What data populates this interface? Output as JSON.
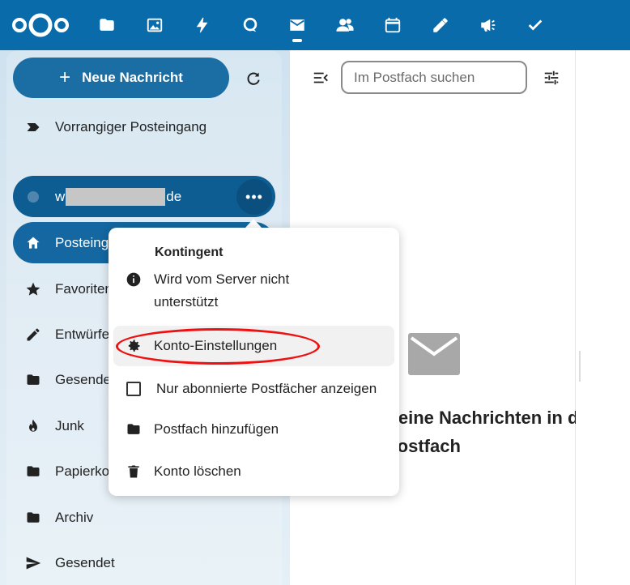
{
  "topbar": {
    "apps": [
      "files",
      "photos",
      "activity",
      "talk",
      "mail",
      "contacts",
      "calendar",
      "notes",
      "announcements",
      "tasks"
    ]
  },
  "sidebar": {
    "new_message_label": "Neue Nachricht",
    "priority_inbox_label": "Vorrangiger Posteingang",
    "account_prefix": "w",
    "account_suffix": "de",
    "inbox_label": "Posteing",
    "folders": [
      {
        "label": "Favoriten",
        "icon": "star-icon"
      },
      {
        "label": "Entwürfe",
        "icon": "pencil-icon"
      },
      {
        "label": "Gesendet",
        "icon": "folder-icon"
      },
      {
        "label": "Junk",
        "icon": "fire-icon"
      },
      {
        "label": "Papierkorb",
        "icon": "folder-icon"
      },
      {
        "label": "Archiv",
        "icon": "folder-icon"
      },
      {
        "label": "Gesendet",
        "icon": "send-icon"
      }
    ]
  },
  "list": {
    "search_placeholder": "Im Postfach suchen",
    "empty_line1": "Keine Nachrichten in diesem",
    "empty_line2": "Postfach"
  },
  "menu": {
    "quota_title": "Kontingent",
    "quota_text_line1": "Wird vom Server nicht",
    "quota_text_line2": "unterstützt",
    "settings_label": "Konto-Einstellungen",
    "subscribed_only_label": "Nur abonnierte Postfächer anzeigen",
    "add_mailbox_label": "Postfach hinzufügen",
    "delete_account_label": "Konto löschen"
  },
  "colors": {
    "header": "#0a6bab",
    "account_active": "#0e5d92",
    "inbox_active": "#1467a0",
    "annotation": "#ee1111"
  }
}
